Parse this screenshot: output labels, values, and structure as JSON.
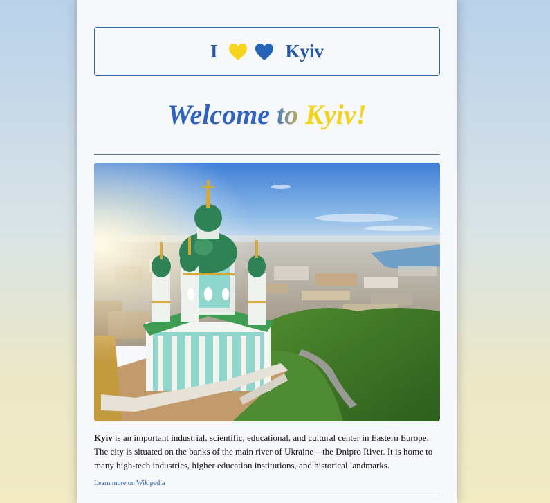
{
  "header": {
    "word_i": "I",
    "city": "Kyiv",
    "heart_colors": [
      "#f7d51d",
      "#2563b6"
    ]
  },
  "welcome": {
    "part1": "Welcome",
    "part2": "to",
    "part3": "Kyiv!"
  },
  "image": {
    "alt": "St. Andrew's Church overlooking Kyiv and the Dnipro River"
  },
  "description": {
    "bold": "Kyiv",
    "text": " is an important industrial, scientific, educational, and cultural center in Eastern Europe. The city is situated on the banks of the main river of Ukraine—the Dnipro River. It is home to many high-tech industries, higher education institutions, and historical landmarks."
  },
  "wiki_link": {
    "label": "Learn more on Wikipedia"
  }
}
